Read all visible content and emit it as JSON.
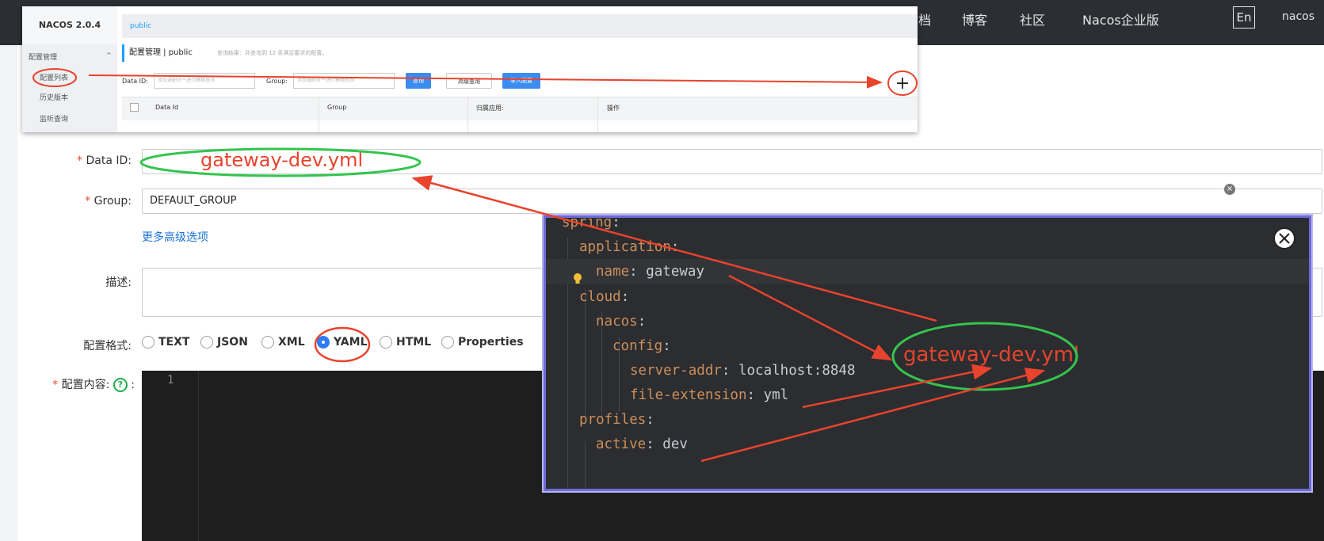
{
  "topnav": {
    "items": [
      "文档",
      "博客",
      "社区",
      "Nacos企业版"
    ],
    "lang": "En",
    "user": "nacos"
  },
  "thumb": {
    "brand": "NACOS 2.0.4",
    "menu": {
      "group": "配置管理",
      "items": [
        "配置列表",
        "历史版本",
        "监听查询"
      ]
    },
    "crumb": "public",
    "title": "配置管理 | public",
    "query_note": "查询结果：共查询到 12 条满足要求的配置。",
    "search": {
      "dataid_label": "Data ID:",
      "dataid_placeholder": "添加通配符'*'进行模糊查询",
      "group_label": "Group:",
      "group_placeholder": "添加通配符'*'进行模糊查询",
      "query_button": "查询",
      "advanced_button": "高级查询",
      "import_button": "导入配置"
    },
    "table_headers": [
      "Data Id",
      "Group",
      "归属应用:",
      "操作"
    ]
  },
  "form": {
    "dataid_label": "Data ID:",
    "group_label": "Group:",
    "group_value": "DEFAULT_GROUP",
    "more_options": "更多高级选项",
    "desc_label": "描述:",
    "format_label": "配置格式:",
    "formats": [
      "TEXT",
      "JSON",
      "XML",
      "YAML",
      "HTML",
      "Properties"
    ],
    "selected_format": "YAML",
    "content_label": "配置内容:",
    "help_glyph": "?",
    "line_number": "1"
  },
  "code": {
    "lines": [
      {
        "key": "spring",
        "value": ""
      },
      {
        "key": "application",
        "value": ""
      },
      {
        "key": "name",
        "value": "gateway"
      },
      {
        "key": "cloud",
        "value": ""
      },
      {
        "key": "nacos",
        "value": ""
      },
      {
        "key": "config",
        "value": ""
      },
      {
        "key": "server-addr",
        "value": "localhost:8848"
      },
      {
        "key": "file-extension",
        "value": "yml"
      },
      {
        "key": "profiles",
        "value": ""
      },
      {
        "key": "active",
        "value": "dev"
      }
    ]
  },
  "annotations": {
    "dataid_handwritten": "gateway-dev.yml",
    "result_handwritten": "gateway-dev.yml",
    "plus_glyph": "+"
  },
  "colors": {
    "annotation_red": "#e8432c",
    "annotation_green": "#34c44e",
    "accent_blue": "#2f7cf6",
    "code_key": "#cc8f5b",
    "code_frame": "#6e6ad8"
  }
}
